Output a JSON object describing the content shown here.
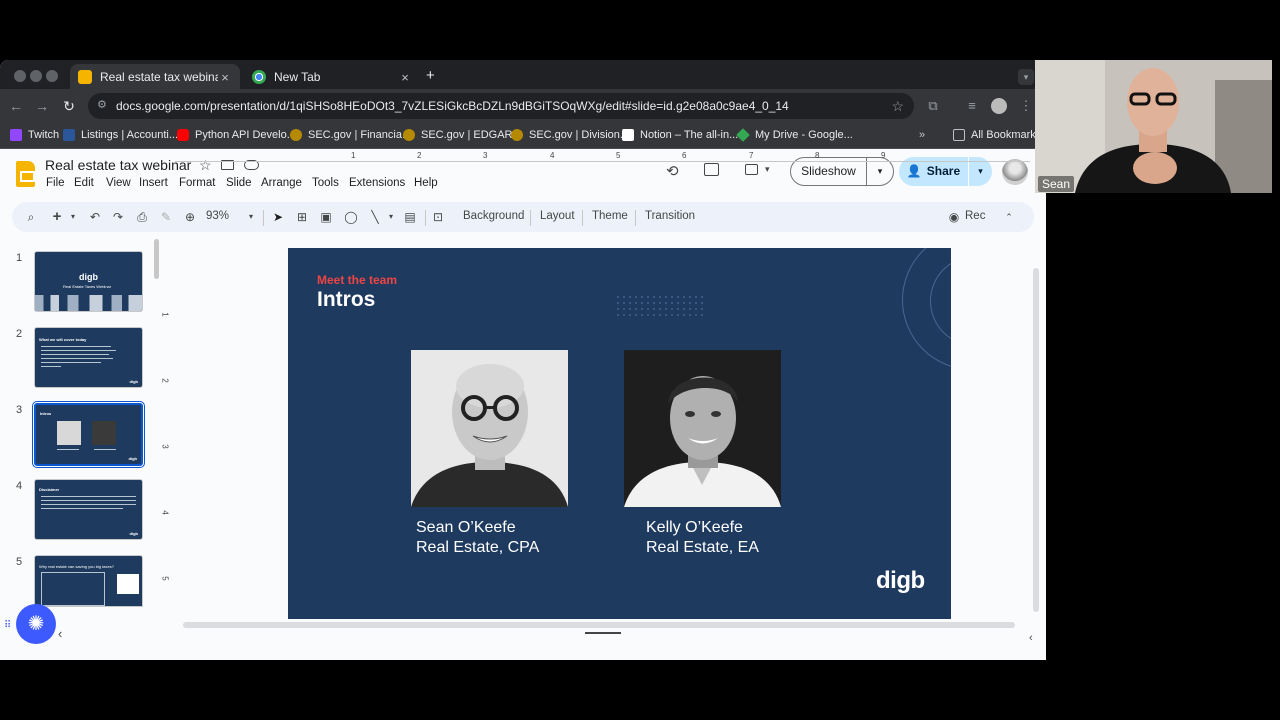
{
  "browser": {
    "tabs": [
      {
        "title": "Real estate tax webinar - Goo",
        "active": true,
        "icon": "slides-icon"
      },
      {
        "title": "New Tab",
        "active": false,
        "icon": "chrome-icon"
      }
    ],
    "new_tab_symbol": "+",
    "close_symbol": "×",
    "url": "docs.google.com/presentation/d/1qiSHSo8HEoDOt3_7vZLESiGkcBcDZLn9dBGiTSOqWXg/edit#slide=id.g2e08a0c9ae4_0_14",
    "bookmarks": [
      {
        "label": "Twitch",
        "icon_color": "#9146ff"
      },
      {
        "label": "Listings | Accounti...",
        "icon_color": "#2b579a"
      },
      {
        "label": "Python API Develo...",
        "icon_color": "#ff0000"
      },
      {
        "label": "SEC.gov | Financia...",
        "icon_color": "#b58a00"
      },
      {
        "label": "SEC.gov | EDGAR...",
        "icon_color": "#b58a00"
      },
      {
        "label": "SEC.gov | Division...",
        "icon_color": "#b58a00"
      },
      {
        "label": "Notion – The all-in...",
        "icon_color": "#ffffff"
      },
      {
        "label": "My Drive - Google...",
        "icon_color": "#34a853"
      }
    ],
    "more_bookmarks": "»",
    "all_bookmarks": "All Bookmarks"
  },
  "docs": {
    "title": "Real estate tax webinar",
    "menu": [
      "File",
      "Edit",
      "View",
      "Insert",
      "Format",
      "Slide",
      "Arrange",
      "Tools",
      "Extensions",
      "Help"
    ],
    "slideshow_label": "Slideshow",
    "share_label": "Share",
    "zoom": "93%",
    "toolbar_text": {
      "background": "Background",
      "layout": "Layout",
      "theme": "Theme",
      "transition": "Transition",
      "rec": "Rec"
    }
  },
  "filmstrip": {
    "slides": [
      {
        "num": "1",
        "title": "digb",
        "subtitle": "Real Estate Taxes Webinar"
      },
      {
        "num": "2",
        "title": "What we will cover today"
      },
      {
        "num": "3",
        "title": "Intros"
      },
      {
        "num": "4",
        "title": "Disclaimer"
      },
      {
        "num": "5",
        "title": "Why real estate can saving you big taxes?"
      }
    ]
  },
  "ruler": {
    "h": [
      "1",
      "2",
      "3",
      "4",
      "5",
      "6",
      "7",
      "8",
      "9"
    ],
    "v": [
      "1",
      "2",
      "3",
      "4",
      "5"
    ]
  },
  "slide": {
    "kicker": "Meet the team",
    "title": "Intros",
    "people": [
      {
        "name": "Sean O’Keefe",
        "role": "Real Estate, CPA"
      },
      {
        "name": "Kelly O’Keefe",
        "role": "Real Estate, EA"
      }
    ],
    "logo": "digb",
    "background_color": "#1e3a5f",
    "accent_color": "#ef4444"
  },
  "webcam": {
    "name": "Sean"
  }
}
